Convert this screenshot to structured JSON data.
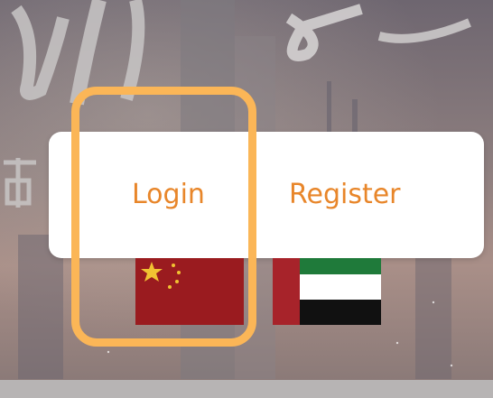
{
  "auth": {
    "login_label": "Login",
    "register_label": "Register"
  },
  "languages": [
    {
      "name": "china-flag"
    },
    {
      "name": "uae-flag"
    }
  ],
  "colors": {
    "accent": "#e8862a",
    "highlight": "#fbb657"
  }
}
